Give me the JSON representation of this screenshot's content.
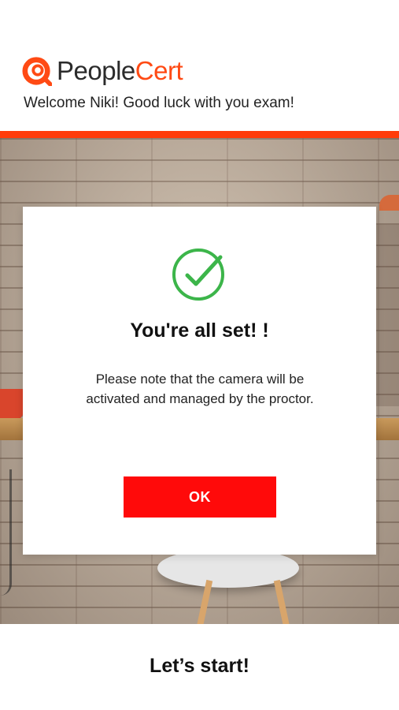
{
  "brand": {
    "name_part1": "People",
    "name_part2": "Cert",
    "primary_color": "#ff4a14",
    "text_color": "#2b2b2b"
  },
  "header": {
    "welcome_text": "Welcome Niki! Good luck with you exam!"
  },
  "dialog": {
    "icon": "check-circle-icon",
    "icon_color": "#3cb54a",
    "title": "You're all set! !",
    "message": "Please note that the camera will be activated and managed by the proctor.",
    "ok_label": "OK",
    "button_color": "#ff0a0a"
  },
  "footer": {
    "title": "Let’s start!"
  }
}
